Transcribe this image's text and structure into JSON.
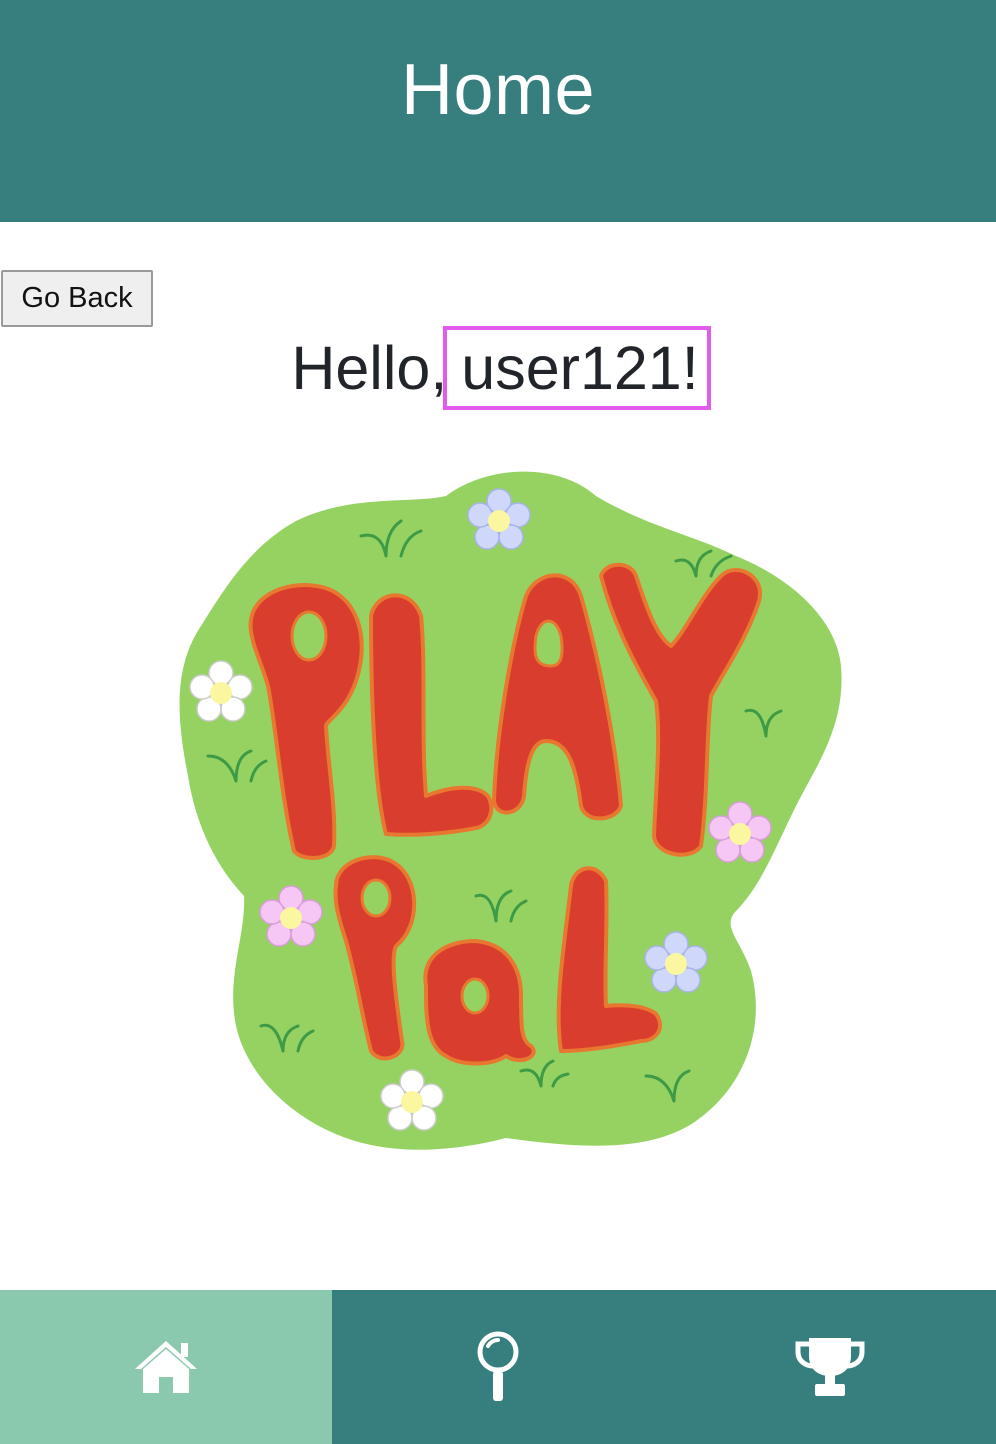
{
  "header": {
    "title": "Home"
  },
  "actions": {
    "back_label": "Go Back"
  },
  "greeting": {
    "prefix": "Hello,",
    "username": "user121!"
  },
  "logo": {
    "line1": "PLAY",
    "line2": "PaL"
  },
  "nav": {
    "items": [
      {
        "icon": "home-icon",
        "active": true
      },
      {
        "icon": "pin-icon",
        "active": false
      },
      {
        "icon": "trophy-icon",
        "active": false
      }
    ]
  },
  "colors": {
    "primary": "#377f7e",
    "active_tab": "#8bc9ae",
    "highlight": "#e25bec",
    "logo_green": "#95d262",
    "logo_red": "#d93d2e"
  }
}
